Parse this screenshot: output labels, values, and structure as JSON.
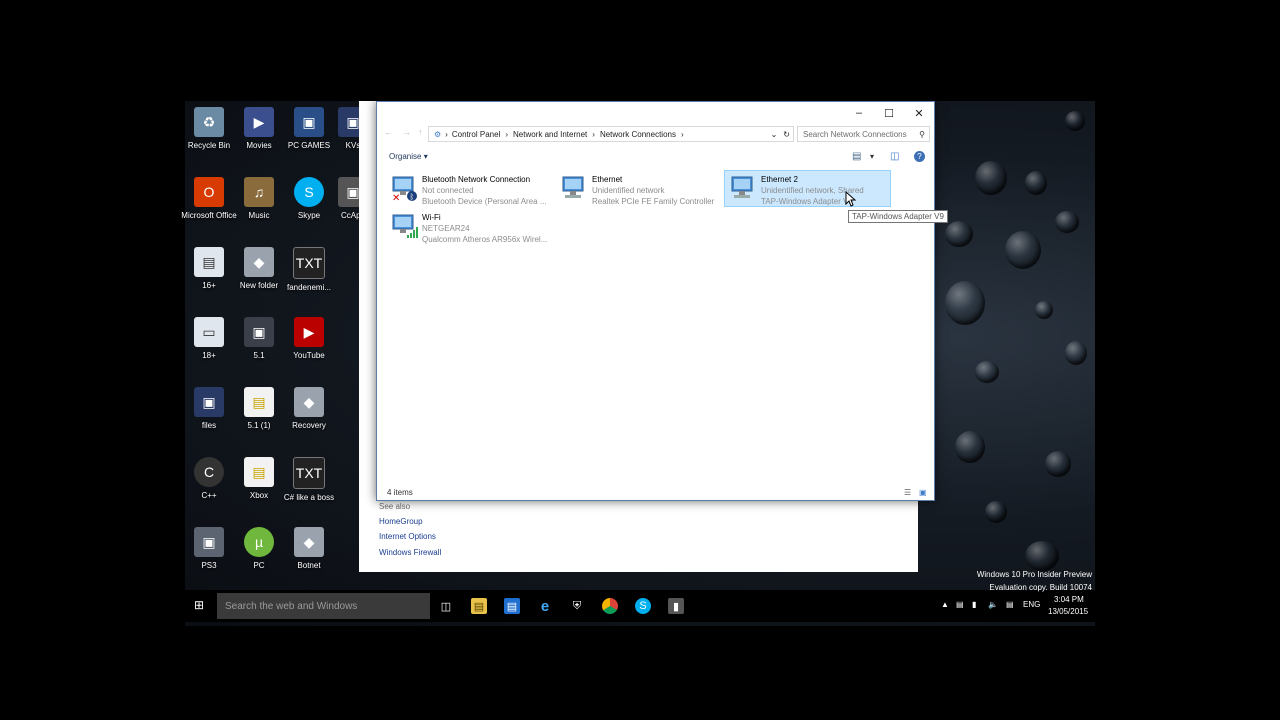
{
  "desktop": {
    "icons": [
      {
        "label": "Recycle Bin",
        "icon": "recycle-bin-icon"
      },
      {
        "label": "Movies",
        "icon": "folder-shortcut-icon"
      },
      {
        "label": "PC GAMES",
        "icon": "folder-shortcut-icon"
      },
      {
        "label": "KVs",
        "icon": "folder-shortcut-icon"
      },
      {
        "label": "Microsoft Office",
        "icon": "office-icon"
      },
      {
        "label": "Music",
        "icon": "music-folder-icon"
      },
      {
        "label": "Skype",
        "icon": "skype-icon"
      },
      {
        "label": "CcApp",
        "icon": "app-icon"
      },
      {
        "label": "16+",
        "icon": "file-icon"
      },
      {
        "label": "New folder",
        "icon": "folder-shortcut-icon"
      },
      {
        "label": "fandenemi...",
        "icon": "text-file-icon"
      },
      {
        "label": "18+",
        "icon": "folder-icon"
      },
      {
        "label": "5.1",
        "icon": "folder-shortcut-icon"
      },
      {
        "label": "YouTube",
        "icon": "youtube-icon"
      },
      {
        "label": "files",
        "icon": "folder-shortcut-icon"
      },
      {
        "label": "5.1 (1)",
        "icon": "document-icon"
      },
      {
        "label": "Recovery",
        "icon": "folder-shortcut-icon"
      },
      {
        "label": "C++",
        "icon": "cpp-icon"
      },
      {
        "label": "Xbox",
        "icon": "document-icon"
      },
      {
        "label": "C# like a boss",
        "icon": "text-file-icon"
      },
      {
        "label": "PS3",
        "icon": "folder-shortcut-icon"
      },
      {
        "label": "PC",
        "icon": "utorrent-icon"
      },
      {
        "label": "Botnet",
        "icon": "folder-shortcut-icon"
      }
    ]
  },
  "background_panel": {
    "see_also": "See also",
    "links": [
      "HomeGroup",
      "Internet Options",
      "Windows Firewall"
    ]
  },
  "explorer": {
    "breadcrumb": [
      "Control Panel",
      "Network and Internet",
      "Network Connections"
    ],
    "search_placeholder": "Search Network Connections",
    "toolbar": {
      "organise": "Organise"
    },
    "connections": [
      {
        "name": "Bluetooth Network Connection",
        "status": "Not connected",
        "device": "Bluetooth Device (Personal Area ...",
        "selected": false
      },
      {
        "name": "Ethernet",
        "status": "Unidentified network",
        "device": "Realtek PCIe FE Family Controller",
        "selected": false
      },
      {
        "name": "Ethernet 2",
        "status": "Unidentified network, Shared",
        "device": "TAP-Windows Adapter V9",
        "selected": true
      },
      {
        "name": "Wi-Fi",
        "status": "NETGEAR24",
        "device": "Qualcomm Atheros AR956x Wirel...",
        "selected": false
      }
    ],
    "tooltip": "TAP-Windows Adapter V9",
    "status_count": "4 items"
  },
  "taskbar": {
    "search_placeholder": "Search the web and Windows",
    "language": "ENG",
    "time": "3:04 PM",
    "date": "13/05/2015"
  },
  "watermark": {
    "line1": "Windows 10 Pro Insider Preview",
    "line2": "Evaluation copy. Build 10074"
  },
  "colors": {
    "selection": "#cce8ff",
    "link": "#1a3e8f",
    "accent": "#0078d7"
  }
}
